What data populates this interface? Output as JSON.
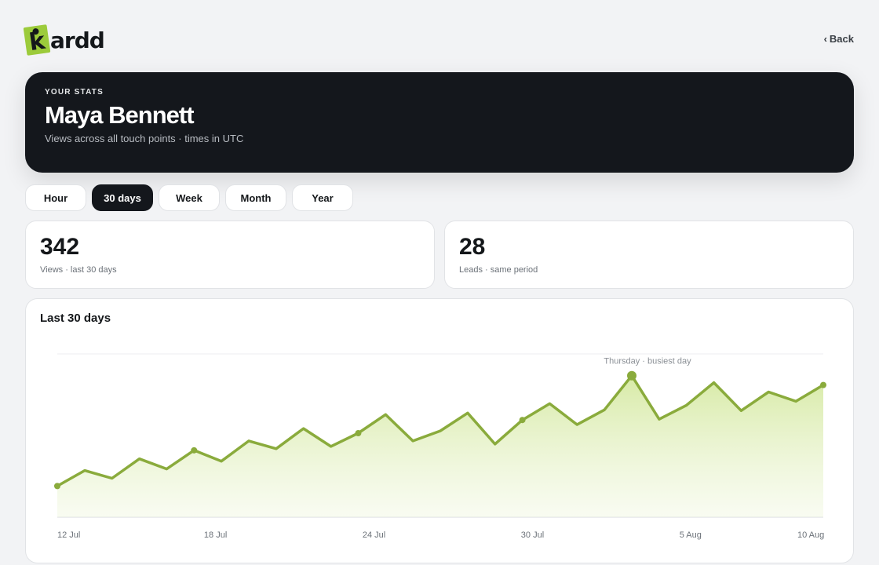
{
  "app": {
    "brand": "kardd"
  },
  "nav": {
    "back_label": "Back"
  },
  "hero": {
    "eyebrow": "YOUR STATS",
    "name": "Maya Bennett",
    "subtitle": "Views across all touch points · times in UTC"
  },
  "tabs": [
    {
      "label": "Hour",
      "active": false
    },
    {
      "label": "30 days",
      "active": true
    },
    {
      "label": "Week",
      "active": false
    },
    {
      "label": "Month",
      "active": false
    },
    {
      "label": "Year",
      "active": false
    }
  ],
  "stats": [
    {
      "value": "342",
      "label": "Views · last 30 days"
    },
    {
      "value": "28",
      "label": "Leads · same period"
    }
  ],
  "colors": {
    "accent": "#8aab3c",
    "fill": "#d9ebaa",
    "dark": "#14171c"
  },
  "chart_data": {
    "type": "area",
    "title": "Last 30 days",
    "xlabel": "",
    "ylabel": "",
    "x_ticks": [
      "12 Jul",
      "18 Jul",
      "24 Jul",
      "30 Jul",
      "5 Aug",
      "10 Aug"
    ],
    "x_start": "12 Jul",
    "x_end": "10 Aug",
    "values": [
      4,
      6,
      5,
      7.5,
      6.2,
      8.6,
      7.2,
      9.8,
      8.8,
      11.4,
      9.1,
      10.8,
      13.2,
      9.8,
      11.1,
      13.4,
      9.4,
      12.5,
      14.6,
      11.9,
      13.8,
      18.2,
      12.6,
      14.4,
      17.3,
      13.7,
      16.1,
      14.9,
      17.0
    ],
    "ylim": [
      0,
      21
    ],
    "marker_indices": [
      0,
      5,
      11,
      17,
      28
    ],
    "highlight": {
      "index": 21,
      "label": "Thursday · busiest day"
    },
    "grid": "top-line-only"
  }
}
